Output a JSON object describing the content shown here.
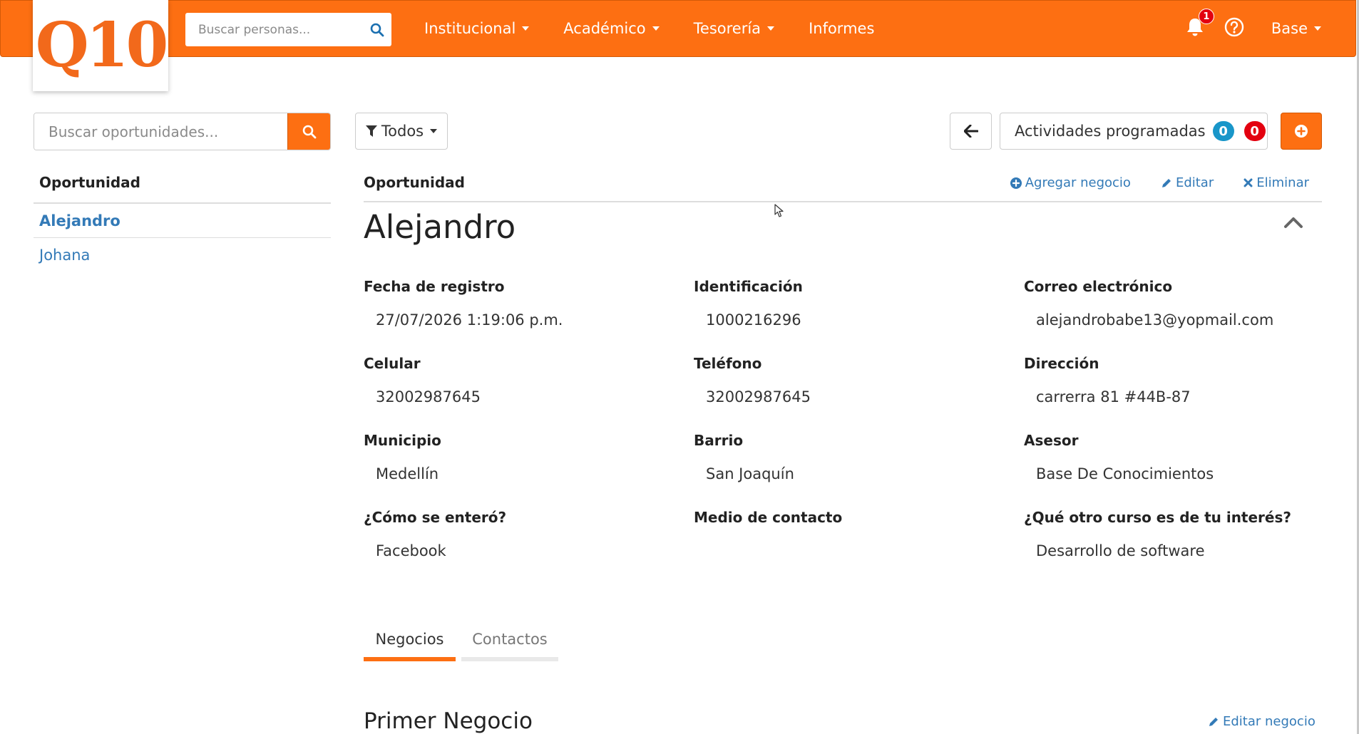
{
  "navbar": {
    "logo_text": "Q10",
    "search_placeholder": "Buscar personas...",
    "menu": [
      {
        "label": "Institucional",
        "has_dropdown": true
      },
      {
        "label": "Académico",
        "has_dropdown": true
      },
      {
        "label": "Tesorería",
        "has_dropdown": true
      },
      {
        "label": "Informes",
        "has_dropdown": false
      }
    ],
    "notifications_count": "1",
    "user_label": "Base",
    "icons": [
      "search-icon",
      "bell-icon",
      "help-icon",
      "caret-down-icon"
    ],
    "color": "#fd6f12"
  },
  "sidebar": {
    "search_placeholder": "Buscar oportunidades...",
    "header": "Oportunidad",
    "items": [
      {
        "label": "Alejandro",
        "active": true
      },
      {
        "label": "Johana",
        "active": false
      }
    ]
  },
  "toolbar": {
    "filter_label": "Todos",
    "activities_label": "Actividades programadas",
    "activities_count_blue": "0",
    "activities_count_red": "0"
  },
  "detail": {
    "header": "Oportunidad",
    "actions": {
      "add_business": "Agregar negocio",
      "edit": "Editar",
      "delete": "Eliminar"
    },
    "name": "Alejandro",
    "fields": [
      {
        "label": "Fecha de registro",
        "value": "27/07/2026 1:19:06 p.m."
      },
      {
        "label": "Identificación",
        "value": "1000216296"
      },
      {
        "label": "Correo electrónico",
        "value": "alejandrobabe13@yopmail.com"
      },
      {
        "label": "Celular",
        "value": "32002987645"
      },
      {
        "label": "Teléfono",
        "value": "32002987645"
      },
      {
        "label": "Dirección",
        "value": "carrerra 81 #44B-87"
      },
      {
        "label": "Municipio",
        "value": "Medellín"
      },
      {
        "label": "Barrio",
        "value": "San Joaquín"
      },
      {
        "label": "Asesor",
        "value": "Base De Conocimientos"
      },
      {
        "label": "¿Cómo se enteró?",
        "value": "Facebook"
      },
      {
        "label": "Medio de contacto",
        "value": ""
      },
      {
        "label": "¿Qué otro curso es de tu interés?",
        "value": "Desarrollo de software"
      }
    ]
  },
  "tabs": [
    {
      "label": "Negocios",
      "active": true
    },
    {
      "label": "Contactos",
      "active": false
    }
  ],
  "business": {
    "title": "Primer Negocio",
    "edit_label": "Editar negocio"
  },
  "colors": {
    "accent": "#fd6f12",
    "link": "#337ab7",
    "badge_blue": "#1996c9",
    "badge_red": "#e3000f"
  }
}
